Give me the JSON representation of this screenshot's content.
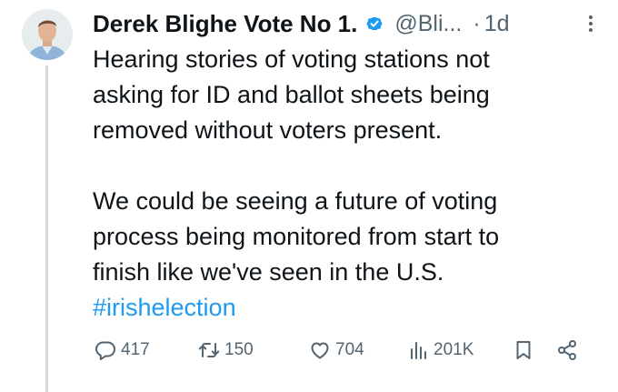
{
  "author": {
    "display_name": "Derek Blighe Vote No 1.",
    "handle": "@Bli...",
    "verified": true,
    "avatar": "avatar-photo"
  },
  "timestamp": "1d",
  "timestamp_separator": "·",
  "tweet": {
    "paragraph1_lines": [
      "Hearing stories of voting stations not",
      "asking for ID and ballot sheets being",
      "removed without voters present."
    ],
    "paragraph2_lines": [
      "We could be seeing a future of voting",
      "process being monitored from start to",
      "finish like we've seen in the U.S."
    ],
    "hashtag": "#irishelection"
  },
  "actions": {
    "replies": "417",
    "reposts": "150",
    "likes": "704",
    "views": "201K"
  },
  "colors": {
    "text": "#0f1419",
    "muted": "#536471",
    "accent": "#1d9bf0",
    "thread_line": "#cfd9de"
  },
  "icons": {
    "reply": "reply-icon",
    "repost": "repost-icon",
    "like": "heart-icon",
    "views": "views-icon",
    "bookmark": "bookmark-icon",
    "share": "share-icon",
    "more": "more-icon",
    "verified": "verified-badge-icon"
  }
}
